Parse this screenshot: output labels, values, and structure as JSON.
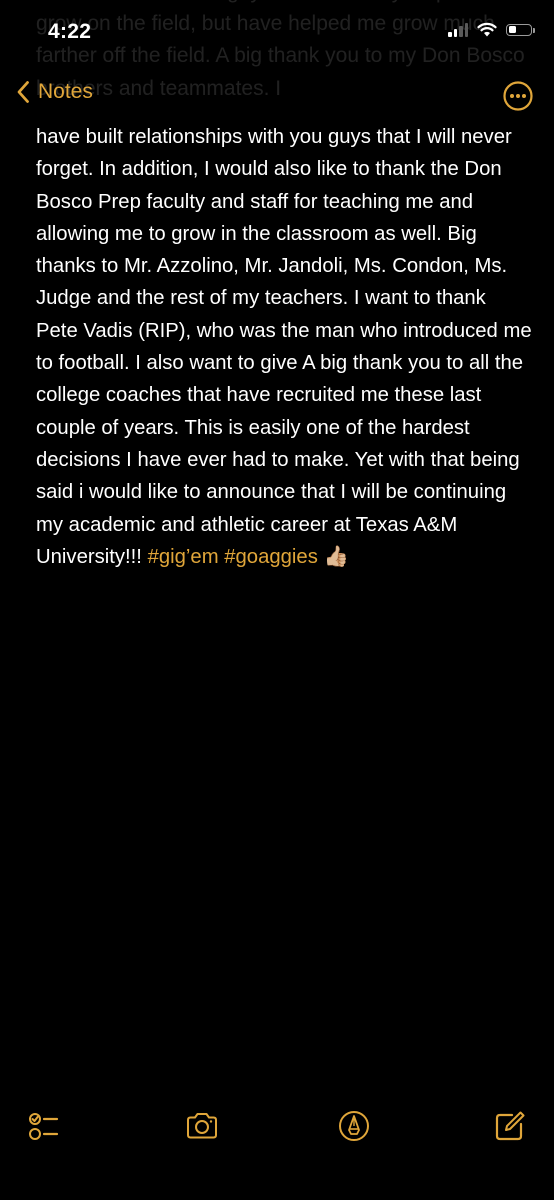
{
  "status_bar": {
    "time": "4:22"
  },
  "nav": {
    "back_label": "Notes",
    "more_icon": "ellipsis-circle-icon"
  },
  "accent_color": "#e0a63a",
  "ghost_text": "rest of the staff. You guys have not only helped me grow on the field, but have helped me grow much farther off the field. A big thank you to my Don Bosco brothers and teammates. I",
  "note": {
    "text_1": "have built relationships with you guys that I will never forget. In addition, I would also like to thank the Don Bosco Prep faculty and staff for teaching me and allowing me to grow in the classroom as well.  Big thanks to Mr. Azzolino, Mr. Jandoli, Ms. Condon, Ms. Judge and the rest of my teachers. I want to thank Pete Vadis (RIP), who was the man who introduced me to football. I also want to give A big thank you to all the college coaches that have recruited me these last couple of years. This is easily one of the hardest decisions I have ever had to make. Yet with that being said i would like to announce that I will be continuing my academic and athletic career at Texas A&M University!!! ",
    "tag_1": "#gig’em",
    "tag_2": "#goaggies",
    "emoji": "👍🏼"
  },
  "toolbar": {
    "checklist_icon": "checklist-icon",
    "camera_icon": "camera-icon",
    "markup_icon": "markup-pen-icon",
    "compose_icon": "compose-icon"
  }
}
